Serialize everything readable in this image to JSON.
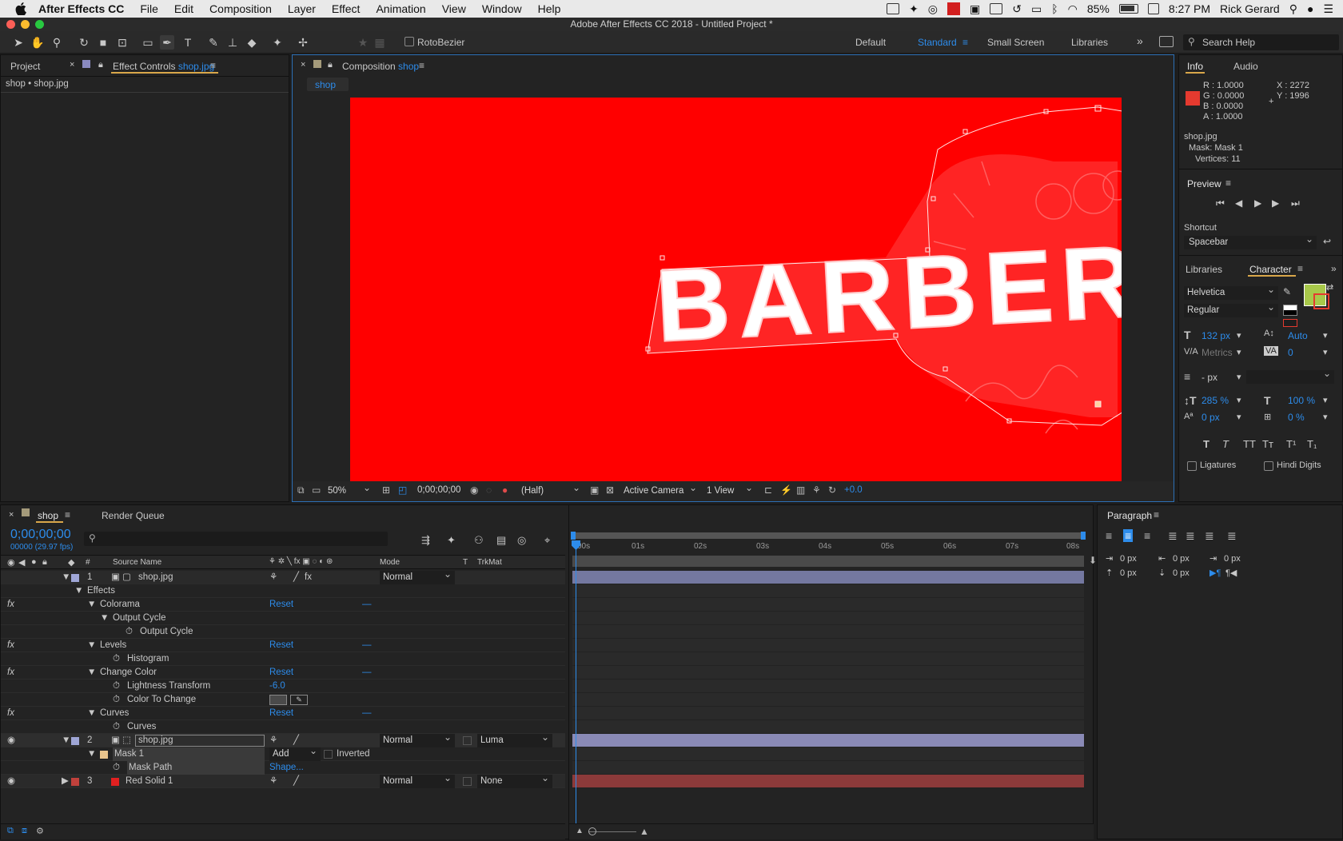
{
  "menubar": {
    "app_name": "After Effects CC",
    "items": [
      "File",
      "Edit",
      "Composition",
      "Layer",
      "Effect",
      "Animation",
      "View",
      "Window",
      "Help"
    ],
    "battery": "85%",
    "time": "8:27 PM",
    "user": "Rick Gerard"
  },
  "window": {
    "title": "Adobe After Effects CC 2018 - Untitled Project *"
  },
  "toolbar": {
    "rotobezier_label": "RotoBezier",
    "workspaces": [
      "Default",
      "Standard",
      "Small Screen",
      "Libraries"
    ],
    "active_workspace": "Standard",
    "search_placeholder": "Search Help"
  },
  "left_panel": {
    "tab_project": "Project",
    "tab_effect_controls_prefix": "Effect Controls",
    "tab_effect_controls_file": "shop.jpg",
    "breadcrumb": "shop • shop.jpg"
  },
  "composition_panel": {
    "tab_prefix": "Composition",
    "tab_name": "shop",
    "subtab": "shop",
    "overlay_text": "BARBER",
    "footer": {
      "zoom": "50%",
      "timecode": "0;00;00;00",
      "resolution": "(Half)",
      "camera": "Active Camera",
      "views": "1 View",
      "exposure": "+0.0"
    },
    "colors": {
      "background": "#ff0000"
    }
  },
  "info_panel": {
    "tab_info": "Info",
    "tab_audio": "Audio",
    "r": "R : 1.0000",
    "g": "G : 0.0000",
    "b": "B : 0.0000",
    "a": "A : 1.0000",
    "x": "X : 2272",
    "y": "Y : 1996",
    "file": "shop.jpg",
    "mask": "Mask: Mask 1",
    "vertices": "Vertices: 11"
  },
  "preview_panel": {
    "title": "Preview",
    "shortcut_label": "Shortcut",
    "shortcut_value": "Spacebar"
  },
  "character_panel": {
    "tab_libraries": "Libraries",
    "tab_character": "Character",
    "font": "Helvetica",
    "style": "Regular",
    "font_size": "132 px",
    "leading": "Auto",
    "kerning": "Metrics",
    "tracking": "0",
    "stroke": "- px",
    "vscale": "285 %",
    "hscale": "100 %",
    "baseline": "0 px",
    "tsume": "0 %",
    "style_buttons": [
      "T",
      "T",
      "TT",
      "Tт",
      "T¹",
      "T₁"
    ],
    "ligatures": "Ligatures",
    "hindi_digits": "Hindi Digits",
    "fill_color": "#a8c84a"
  },
  "timeline": {
    "tab_shop": "shop",
    "tab_render_queue": "Render Queue",
    "timecode": "0;00;00;00",
    "frame_info": "00000 (29.97 fps)",
    "search_placeholder": "",
    "columns": {
      "hash": "#",
      "source_name": "Source Name",
      "mode": "Mode",
      "t": "T",
      "trkmat": "TrkMat"
    },
    "ruler_labels": [
      "00s",
      "01s",
      "02s",
      "03s",
      "04s",
      "05s",
      "06s",
      "07s",
      "08s"
    ],
    "rows": {
      "layer1_num": "1",
      "layer1_name": "shop.jpg",
      "layer1_mode": "Normal",
      "effects": "Effects",
      "colorama": "Colorama",
      "reset1": "Reset",
      "output_cycle_group": "Output Cycle",
      "output_cycle": "Output Cycle",
      "levels": "Levels",
      "reset2": "Reset",
      "histogram": "Histogram",
      "change_color": "Change Color",
      "reset3": "Reset",
      "lightness": "Lightness Transform",
      "lightness_val": "-6.0",
      "color_to_change": "Color To Change",
      "curves": "Curves",
      "reset4": "Reset",
      "curves_prop": "Curves",
      "layer2_num": "2",
      "layer2_name": "shop.jpg",
      "layer2_mode": "Normal",
      "layer2_trkmat": "Luma",
      "mask1": "Mask 1",
      "mask_mode": "Add",
      "inverted": "Inverted",
      "mask_path": "Mask Path",
      "mask_path_val": "Shape...",
      "layer3_num": "3",
      "layer3_name": "Red Solid 1",
      "layer3_mode": "Normal",
      "layer3_trkmat": "None"
    }
  },
  "paragraph_panel": {
    "title": "Paragraph",
    "indent_left": "0 px",
    "indent_right": "0 px",
    "indent_first": "0 px",
    "space_before": "0 px",
    "space_after": "0 px"
  }
}
